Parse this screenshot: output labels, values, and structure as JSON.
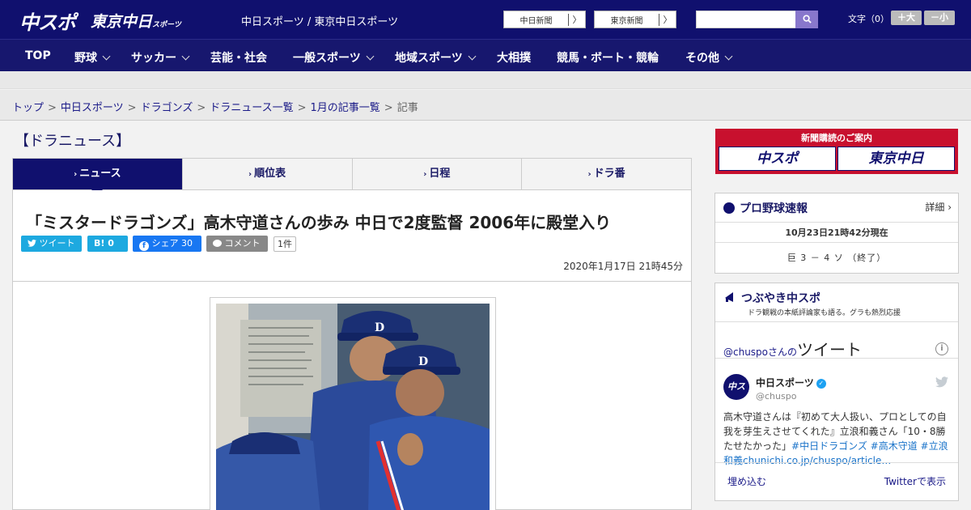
{
  "header": {
    "logo_main": "中スポ",
    "logo_sub": "東京中日",
    "logo_sub_small": "スポーツ",
    "site_title": "中日スポーツ / 東京中日スポーツ",
    "ext_links": [
      {
        "label": "中日新聞",
        "arrow": "〉"
      },
      {
        "label": "東京新聞",
        "arrow": "〉"
      }
    ],
    "search": {
      "placeholder": "",
      "icon": "search-icon"
    },
    "font_size_label": "文字（0）",
    "font_increase": "＋大",
    "font_decrease": "－小"
  },
  "nav": [
    {
      "label": "TOP",
      "dropdown": false
    },
    {
      "label": "野球",
      "dropdown": true
    },
    {
      "label": "サッカー",
      "dropdown": true
    },
    {
      "label": "芸能・社会",
      "dropdown": false
    },
    {
      "label": "一般スポーツ",
      "dropdown": true
    },
    {
      "label": "地域スポーツ",
      "dropdown": true
    },
    {
      "label": "大相撲",
      "dropdown": false
    },
    {
      "label": "競馬・ボート・競輪",
      "dropdown": false
    },
    {
      "label": "その他",
      "dropdown": true
    }
  ],
  "breadcrumb": [
    "トップ",
    "中日スポーツ",
    "ドラゴンズ",
    "ドラニュース一覧",
    "1月の記事一覧",
    "記事"
  ],
  "breadcrumb_sep": ">",
  "section_title": "【ドラニュース】",
  "tabs": [
    {
      "label": "ニュース",
      "chev": "›"
    },
    {
      "label": "順位表",
      "chev": "›"
    },
    {
      "label": "日程",
      "chev": "›"
    },
    {
      "label": "ドラ番",
      "chev": "›"
    }
  ],
  "article": {
    "headline": "「ミスタードラゴンズ」高木守道さんの歩み 中日で2度監督 2006年に殿堂入り",
    "share": {
      "tweet": "ツイート",
      "hatena": "B! 0",
      "facebook": "シェア 30",
      "comment": "コメント",
      "comment_count": "1件"
    },
    "date": "2020年1月17日 21時45分"
  },
  "sidebar": {
    "subscription": {
      "title": "新聞購読のご案内",
      "left": "中スポ",
      "right": "東京中日"
    },
    "baseball": {
      "title": "プロ野球速報",
      "detail": "詳細 ›",
      "time": "10月23日21時42分現在",
      "score": "巨 3 － 4 ソ （終了）"
    },
    "twitter": {
      "title": "つぶやき中スポ",
      "subtitle": "ドラ観戦の本紙評論家も語る。グラも熱烈応援",
      "header_user": "@chuspo",
      "header_san": "さんの",
      "header_big": "ツイート",
      "account_name": "中日スポーツ",
      "account_handle": "@chuspo",
      "avatar_text": "中スポ",
      "tweet_text": "高木守道さんは『初めて大人扱い、プロとしての自我を芽生えさせてくれた』立浪和義さん「10・8勝たせたかった」",
      "tweet_tags": "#中日ドラゴンズ #高木守道 #立浪和義chunichi.co.jp/chuspo/article…",
      "embed": "埋め込む",
      "view_on": "Twitterで表示"
    }
  },
  "colors": {
    "brand": "#10106e",
    "accent": "#c8102e",
    "twitter": "#1da9e0",
    "facebook": "#1877f2"
  }
}
